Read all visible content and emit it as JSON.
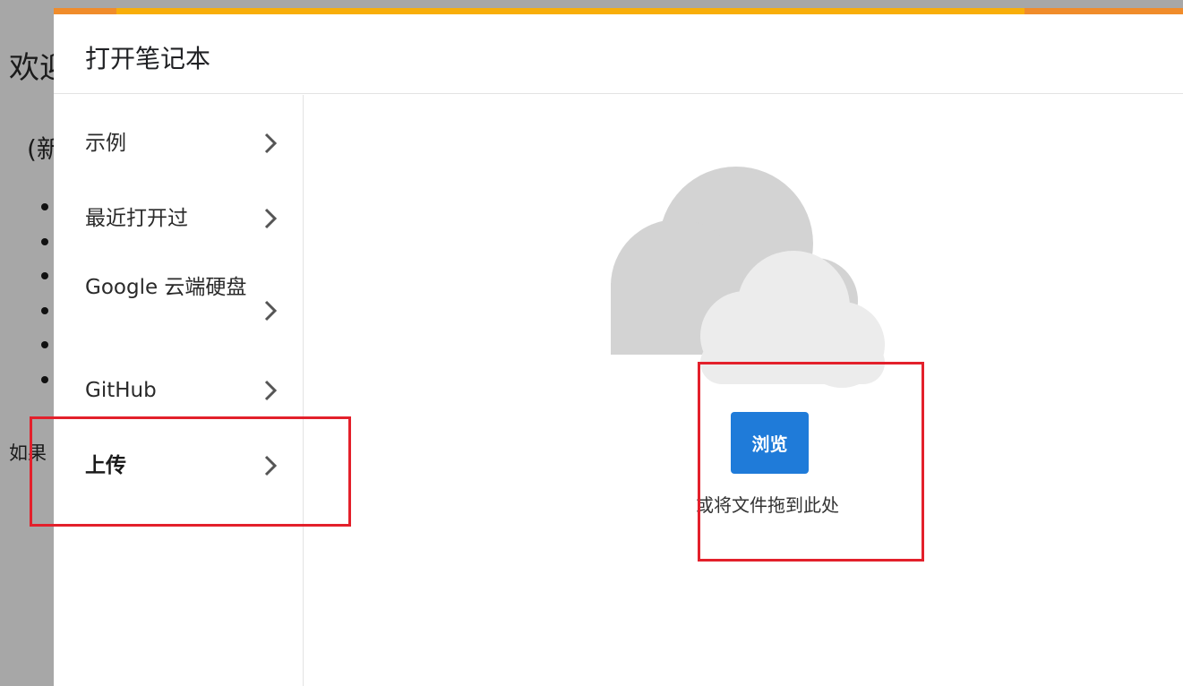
{
  "background": {
    "title": "欢迎",
    "subtitle": "(新",
    "footer": "如果",
    "bullet_count": 6
  },
  "dialog": {
    "title": "打开笔记本",
    "nav": [
      {
        "label": "示例"
      },
      {
        "label": "最近打开过"
      },
      {
        "label": "Google 云端硬盘"
      },
      {
        "label": "GitHub"
      },
      {
        "label": "上传"
      }
    ],
    "active_nav": "上传",
    "upload": {
      "browse_label": "浏览",
      "drop_hint": "或将文件拖到此处"
    }
  },
  "colors": {
    "accent_orange": "#f08c2b",
    "accent_yellow": "#f8ae0a",
    "browse_blue": "#1f7bd9",
    "annotation_red": "#e3202b"
  }
}
